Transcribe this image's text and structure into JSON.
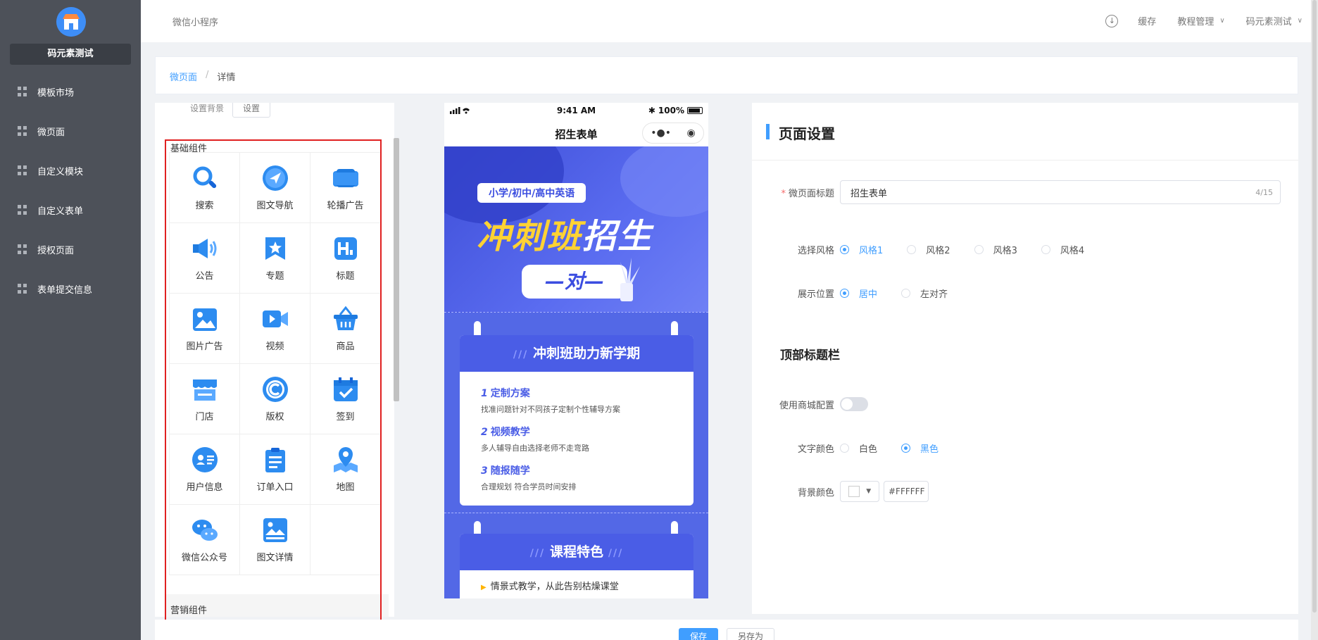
{
  "sidebar": {
    "store_name": "码元素测试",
    "items": [
      {
        "label": "模板市场"
      },
      {
        "label": "微页面"
      },
      {
        "label": "自定义模块"
      },
      {
        "label": "自定义表单"
      },
      {
        "label": "授权页面"
      },
      {
        "label": "表单提交信息"
      }
    ]
  },
  "topbar": {
    "app_name": "微信小程序",
    "cache": "缓存",
    "tutorial": "教程管理",
    "user": "码元素测试"
  },
  "breadcrumb": {
    "link": "微页面",
    "separator": "/",
    "current": "详情"
  },
  "components": {
    "bg_label": "设置背景",
    "bg_button": "设置",
    "basic_title": "基础组件",
    "items": [
      {
        "label": "搜索",
        "icon": "search-icon"
      },
      {
        "label": "图文导航",
        "icon": "navigation-icon"
      },
      {
        "label": "轮播广告",
        "icon": "carousel-icon"
      },
      {
        "label": "公告",
        "icon": "speaker-icon"
      },
      {
        "label": "专题",
        "icon": "star-bookmark-icon"
      },
      {
        "label": "标题",
        "icon": "heading-icon"
      },
      {
        "label": "图片广告",
        "icon": "image-icon"
      },
      {
        "label": "视频",
        "icon": "video-icon"
      },
      {
        "label": "商品",
        "icon": "basket-icon"
      },
      {
        "label": "门店",
        "icon": "store-icon"
      },
      {
        "label": "版权",
        "icon": "copyright-icon"
      },
      {
        "label": "签到",
        "icon": "calendar-check-icon"
      },
      {
        "label": "用户信息",
        "icon": "user-card-icon"
      },
      {
        "label": "订单入口",
        "icon": "clipboard-icon"
      },
      {
        "label": "地图",
        "icon": "map-pin-icon"
      },
      {
        "label": "微信公众号",
        "icon": "wechat-icon"
      },
      {
        "label": "图文详情",
        "icon": "picture-detail-icon"
      }
    ],
    "marketing_title": "营销组件"
  },
  "phone": {
    "time": "9:41 AM",
    "battery": "100%",
    "nav_title": "招生表单",
    "capsule_more": "•●•",
    "capsule_close": "◉",
    "poster": {
      "tag": "小学/初中/高中英语",
      "title_yellow": "冲刺班",
      "title_white": "招生",
      "one_on_one": "—对—",
      "card1_title": "冲刺班助力新学期",
      "features": [
        {
          "num": "1",
          "title": "定制方案",
          "desc": "找准问题针对不同孩子定制个性辅导方案"
        },
        {
          "num": "2",
          "title": "视频教学",
          "desc": "多人辅导自由选择老师不走弯路"
        },
        {
          "num": "3",
          "title": "随报随学",
          "desc": "合理规划 符合学员时间安排"
        }
      ],
      "card2_title": "课程特色",
      "card2_line": "情景式教学，从此告别枯燥课堂"
    }
  },
  "settings": {
    "title": "页面设置",
    "page_title_label": "微页面标题",
    "page_title_value": "招生表单",
    "page_title_count": "4/15",
    "style_label": "选择风格",
    "styles": [
      "风格1",
      "风格2",
      "风格3",
      "风格4"
    ],
    "position_label": "展示位置",
    "positions": [
      "居中",
      "左对齐"
    ],
    "topbar_section": "顶部标题栏",
    "use_mall_label": "使用商城配置",
    "use_mall_on": false,
    "text_color_label": "文字颜色",
    "text_colors": [
      "白色",
      "黑色"
    ],
    "bg_color_label": "背景颜色",
    "bg_color_value": "#FFFFFF"
  },
  "footer": {
    "save": "保存",
    "save_as": "另存为"
  },
  "colors": {
    "sidebar": "#4d5159",
    "accent": "#409eff",
    "poster_blue": "#5368e6",
    "highlight_yellow": "#ffd233"
  }
}
